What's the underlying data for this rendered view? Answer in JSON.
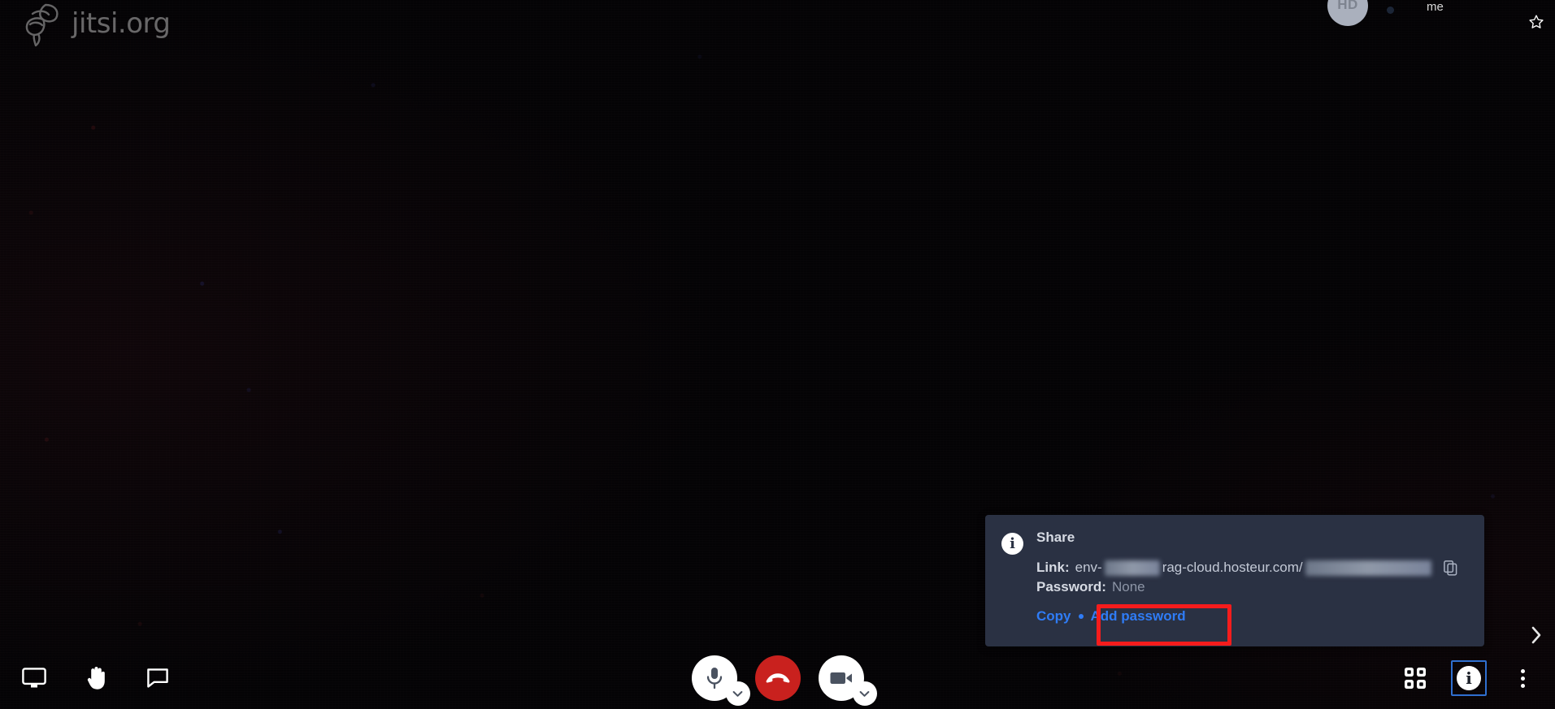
{
  "app": {
    "watermark_text": "jitsi.org",
    "watermark_logo_icon": "jitsi-knot-logo-icon"
  },
  "local_thumbnail": {
    "hd_badge": "HD",
    "display_name": "me",
    "connection_dot_icon": "connection-indicator-dot-icon",
    "favorite_icon": "star-outline-icon"
  },
  "filmstrip": {
    "toggle_icon": "chevron-right-icon"
  },
  "share_panel": {
    "info_icon": "info-circle-icon",
    "info_glyph": "i",
    "title": "Share",
    "link_label": "Link:",
    "link_prefix": "env-",
    "link_domain": "rag-cloud.hosteur.com/",
    "link_redacted_1": "",
    "link_redacted_2": "",
    "copy_icon": "copy-icon",
    "password_label": "Password:",
    "password_value": "None",
    "copy_link_label": "Copy",
    "separator_dot_icon": "bullet-dot-icon",
    "add_password_label": "Add password",
    "accent_link_color": "#2f7cf6",
    "panel_background_color": "#2a3143"
  },
  "annotation": {
    "highlight_color": "#f51c1c",
    "target": "Add password"
  },
  "toolbar": {
    "left": [
      {
        "name": "screen-share-button",
        "icon": "monitor-icon",
        "label": "Share your screen"
      },
      {
        "name": "raise-hand-button",
        "icon": "raised-hand-icon",
        "label": "Raise your hand"
      },
      {
        "name": "chat-button",
        "icon": "chat-bubble-icon",
        "label": "Open / Close chat"
      }
    ],
    "center": [
      {
        "name": "microphone-button",
        "icon": "microphone-icon",
        "label": "Mute / Unmute",
        "has_dropdown": true,
        "dropdown_icon": "chevron-down-icon"
      },
      {
        "name": "hangup-button",
        "icon": "phone-hangup-icon",
        "label": "Leave the meeting",
        "color": "#c9211e"
      },
      {
        "name": "camera-button",
        "icon": "video-camera-icon",
        "label": "Start / Stop camera",
        "has_dropdown": true,
        "dropdown_icon": "chevron-down-icon"
      }
    ],
    "right": [
      {
        "name": "tile-view-button",
        "icon": "tile-view-icon",
        "label": "Toggle tile view",
        "focused": false
      },
      {
        "name": "info-button",
        "icon": "info-circle-icon",
        "glyph": "i",
        "label": "Share meeting link",
        "focused": true
      },
      {
        "name": "more-actions-button",
        "icon": "more-vertical-icon",
        "label": "More actions",
        "focused": false
      }
    ]
  }
}
